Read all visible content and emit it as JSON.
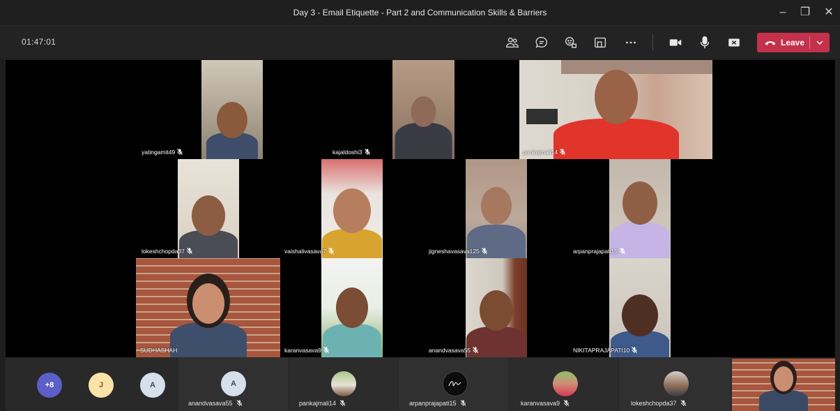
{
  "window": {
    "title": "Day 3 - Email Etiquette - Part 2 and Communication Skills & Barriers",
    "minimize": "–",
    "restore": "❐",
    "close": "✕"
  },
  "toolbar": {
    "timer": "01:47:01",
    "leave_label": "Leave",
    "icons": [
      "people-icon",
      "chat-icon",
      "reactions-icon",
      "rooms-icon",
      "more-icon",
      "camera-icon",
      "mic-icon",
      "share-icon"
    ]
  },
  "colors": {
    "leave": "#c4314b",
    "frame": "#c8363c",
    "background": "#1f1f1f"
  },
  "participants": [
    {
      "name": "yatingamit49"
    },
    {
      "name": "kajaldoshi3"
    },
    {
      "name": "pankajmali14"
    },
    {
      "name": "lokeshchopda37"
    },
    {
      "name": "vaishalivasava7"
    },
    {
      "name": "jigneshavasava125"
    },
    {
      "name": "arpanprajapati15"
    },
    {
      "name": "SUDHASHAH"
    },
    {
      "name": "karanvasava9"
    },
    {
      "name": "anandvasava55"
    },
    {
      "name": "NIKITAPRAJAPATI10"
    }
  ],
  "strip": {
    "overflow_count": "+8",
    "avatar_j": "J",
    "avatar_a1": "A",
    "slots": [
      {
        "initial": "A",
        "name": "anandvasava55"
      },
      {
        "name": "pankajmali14"
      },
      {
        "name": "arpanprajapati15"
      },
      {
        "name": "karanvasava9"
      },
      {
        "name": "lokeshchopda37"
      }
    ]
  }
}
